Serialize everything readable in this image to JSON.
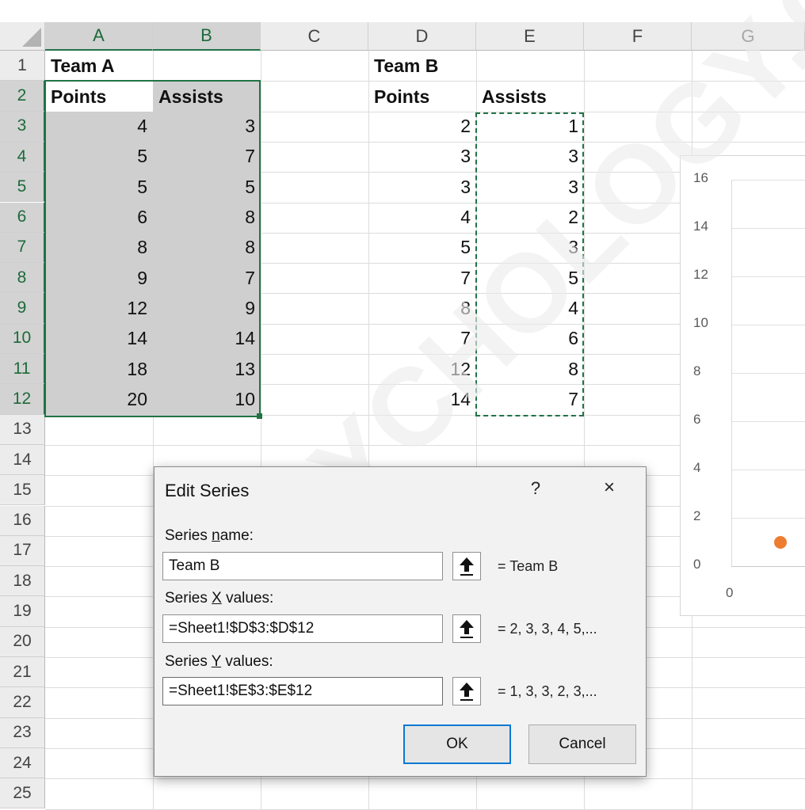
{
  "columns": [
    "A",
    "B",
    "C",
    "D",
    "E",
    "F",
    "G"
  ],
  "rows": [
    "1",
    "2",
    "3",
    "4",
    "5",
    "6",
    "7",
    "8",
    "9",
    "10",
    "11",
    "12",
    "13",
    "14",
    "15",
    "16",
    "17",
    "18",
    "19",
    "20",
    "21",
    "22",
    "23",
    "24",
    "25"
  ],
  "team_a": {
    "title": "Team A",
    "points_header": "Points",
    "assists_header": "Assists",
    "points": [
      "4",
      "5",
      "5",
      "6",
      "8",
      "9",
      "12",
      "14",
      "18",
      "20"
    ],
    "assists": [
      "3",
      "7",
      "5",
      "8",
      "8",
      "7",
      "9",
      "14",
      "13",
      "10"
    ]
  },
  "team_b": {
    "title": "Team B",
    "points_header": "Points",
    "assists_header": "Assists",
    "points": [
      "2",
      "3",
      "3",
      "4",
      "5",
      "7",
      "8",
      "7",
      "12",
      "14"
    ],
    "assists": [
      "1",
      "3",
      "3",
      "2",
      "3",
      "5",
      "4",
      "6",
      "8",
      "7"
    ]
  },
  "chart": {
    "y_ticks": [
      "16",
      "14",
      "12",
      "10",
      "8",
      "6",
      "4",
      "2",
      "0"
    ],
    "x_tick": "0",
    "visible_point": {
      "x": 2,
      "y": 1
    },
    "point_color": "#ed7d31"
  },
  "dialog": {
    "title": "Edit Series",
    "help": "?",
    "close": "×",
    "series_name": {
      "label_pre": "Series ",
      "label_key": "n",
      "label_post": "ame:",
      "value": "Team B",
      "preview": "= Team B"
    },
    "series_x": {
      "label_pre": "Series ",
      "label_key": "X",
      "label_post": " values:",
      "value": "=Sheet1!$D$3:$D$12",
      "preview": "= 2, 3, 3, 4, 5,..."
    },
    "series_y": {
      "label_pre": "Series ",
      "label_key": "Y",
      "label_post": " values:",
      "value": "=Sheet1!$E$3:$E$12",
      "preview": "= 1, 3, 3, 2, 3,..."
    },
    "ok_label": "OK",
    "cancel_label": "Cancel"
  },
  "watermark": "YCHOLOGY.C",
  "colors": {
    "accent_green": "#217346",
    "selection_gray": "#cfcfcf",
    "ok_border": "#0b78d4"
  }
}
